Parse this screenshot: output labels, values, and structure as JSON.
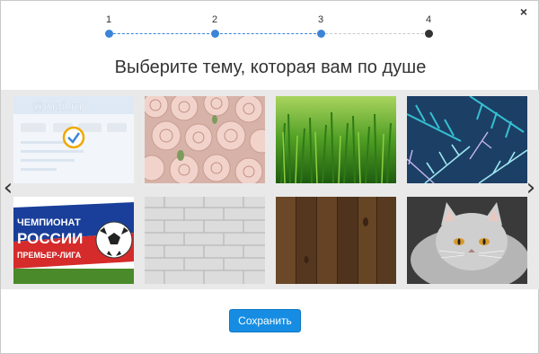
{
  "dialog": {
    "close_glyph": "×",
    "title": "Выберите тему, которая вам по душе",
    "save_label": "Сохранить"
  },
  "stepper": {
    "steps": [
      {
        "label": "1",
        "state": "done"
      },
      {
        "label": "2",
        "state": "done"
      },
      {
        "label": "3",
        "state": "done"
      },
      {
        "label": "4",
        "state": "current"
      }
    ]
  },
  "gallery": {
    "prev_glyph": "‹",
    "next_glyph": "›",
    "themes": [
      {
        "name": "mail-ru",
        "logo_text": "@mail.ru",
        "selected": true
      },
      {
        "name": "roses"
      },
      {
        "name": "grass"
      },
      {
        "name": "fir-branches"
      },
      {
        "name": "football",
        "line1": "ЧЕМПИОНАТ",
        "line2": "РОССИИ",
        "line3": "ПРЕМЬЕР-ЛИГА"
      },
      {
        "name": "white-brick"
      },
      {
        "name": "wood"
      },
      {
        "name": "cat"
      }
    ]
  },
  "colors": {
    "accent": "#3b84d8",
    "button": "#168de2",
    "gallery_bg": "#e9e9e9"
  }
}
